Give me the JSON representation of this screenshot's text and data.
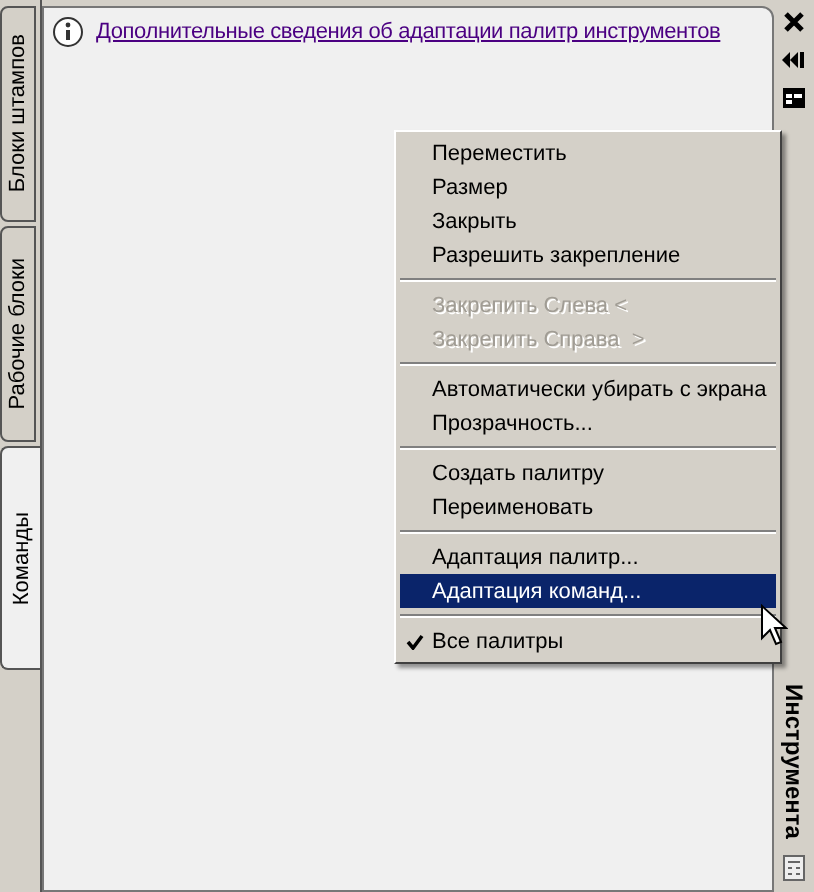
{
  "tabs": [
    {
      "label": "Блоки штампов",
      "selected": false
    },
    {
      "label": "Рабочие блоки",
      "selected": false
    },
    {
      "label": "Команды",
      "selected": true
    }
  ],
  "info_link": "Дополнительные сведения об адаптации палитр инструментов",
  "title_strip": {
    "title": "Инструмента"
  },
  "context_menu": [
    {
      "kind": "item",
      "label": "Переместить",
      "disabled": false,
      "selected": false,
      "checked": false
    },
    {
      "kind": "item",
      "label": "Размер",
      "disabled": false,
      "selected": false,
      "checked": false
    },
    {
      "kind": "item",
      "label": "Закрыть",
      "disabled": false,
      "selected": false,
      "checked": false
    },
    {
      "kind": "item",
      "label": "Разрешить закрепление",
      "disabled": false,
      "selected": false,
      "checked": false
    },
    {
      "kind": "separator"
    },
    {
      "kind": "item",
      "label": "Закрепить Слева <",
      "disabled": true,
      "selected": false,
      "checked": false
    },
    {
      "kind": "item",
      "label": "Закрепить Справа  >",
      "disabled": true,
      "selected": false,
      "checked": false
    },
    {
      "kind": "separator"
    },
    {
      "kind": "item",
      "label": "Автоматически убирать с экрана",
      "disabled": false,
      "selected": false,
      "checked": false
    },
    {
      "kind": "item",
      "label": "Прозрачность...",
      "disabled": false,
      "selected": false,
      "checked": false
    },
    {
      "kind": "separator"
    },
    {
      "kind": "item",
      "label": "Создать палитру",
      "disabled": false,
      "selected": false,
      "checked": false
    },
    {
      "kind": "item",
      "label": "Переименовать",
      "disabled": false,
      "selected": false,
      "checked": false
    },
    {
      "kind": "separator"
    },
    {
      "kind": "item",
      "label": "Адаптация палитр...",
      "disabled": false,
      "selected": false,
      "checked": false
    },
    {
      "kind": "item",
      "label": "Адаптация команд...",
      "disabled": false,
      "selected": true,
      "checked": false
    },
    {
      "kind": "separator"
    },
    {
      "kind": "item",
      "label": "Все палитры",
      "disabled": false,
      "selected": false,
      "checked": true
    }
  ]
}
